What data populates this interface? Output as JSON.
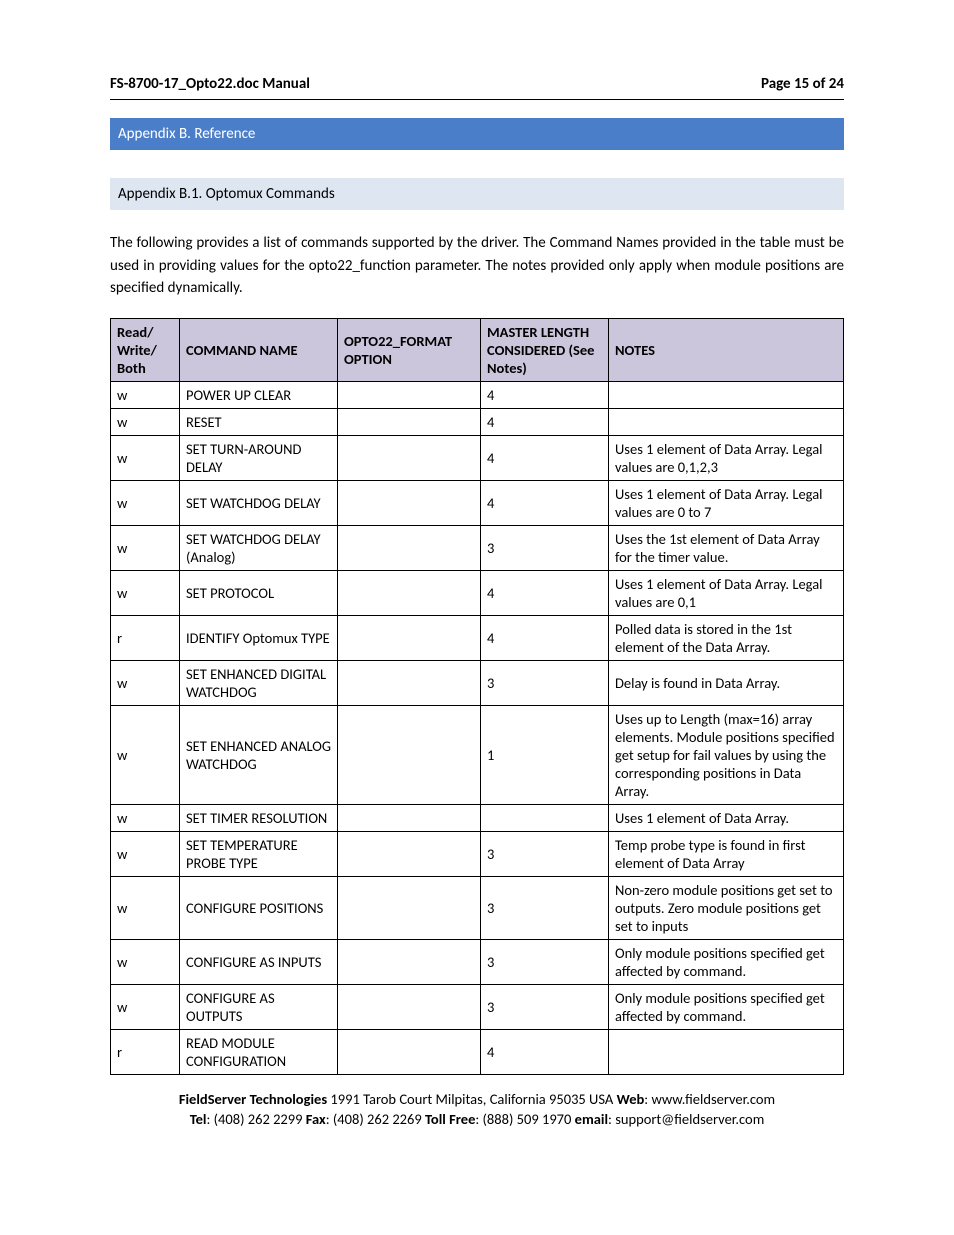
{
  "header": {
    "title": "FS-8700-17_Opto22.doc Manual",
    "page_label": "Page 15 of 24"
  },
  "section_main": "Appendix B.  Reference",
  "section_sub": "Appendix B.1.  Optomux Commands",
  "intro": "The following provides a list of commands supported by the driver.  The Command Names provided in the table must be used in providing values for the opto22_function parameter.  The notes provided only apply when module positions are specified dynamically.",
  "table": {
    "headers": {
      "rwb": "Read/ Write/ Both",
      "name": "COMMAND NAME",
      "fmt": "OPTO22_FORMAT OPTION",
      "len": "MASTER LENGTH CONSIDERED (See Notes)",
      "notes": "NOTES"
    },
    "rows": [
      {
        "rwb": "w",
        "name": "POWER UP CLEAR",
        "fmt": "",
        "len": "4",
        "notes": ""
      },
      {
        "rwb": "w",
        "name": "RESET",
        "fmt": "",
        "len": "4",
        "notes": ""
      },
      {
        "rwb": "w",
        "name": "SET TURN-AROUND DELAY",
        "fmt": "",
        "len": "4",
        "notes": "Uses 1 element of Data Array. Legal values are 0,1,2,3"
      },
      {
        "rwb": "w",
        "name": "SET WATCHDOG DELAY",
        "fmt": "",
        "len": "4",
        "notes": "Uses 1 element of Data Array. Legal values are 0 to 7"
      },
      {
        "rwb": "w",
        "name": "SET WATCHDOG DELAY (Analog)",
        "fmt": "",
        "len": "3",
        "notes": "Uses the 1st element of Data Array for the timer value."
      },
      {
        "rwb": "w",
        "name": "SET PROTOCOL",
        "fmt": "",
        "len": "4",
        "notes": "Uses 1 element of Data Array. Legal values are 0,1"
      },
      {
        "rwb": "r",
        "name": "IDENTIFY Optomux TYPE",
        "fmt": "",
        "len": "4",
        "notes": "Polled data is stored in the 1st element of the Data Array."
      },
      {
        "rwb": "w",
        "name": "SET ENHANCED DIGITAL WATCHDOG",
        "fmt": "",
        "len": "3",
        "notes": "Delay is found in Data Array."
      },
      {
        "rwb": "w",
        "name": "SET ENHANCED ANALOG WATCHDOG",
        "fmt": "",
        "len": "1",
        "notes": "Uses up to Length (max=16) array elements. Module positions specified get setup for fail values by using the corresponding positions in Data Array."
      },
      {
        "rwb": "w",
        "name": "SET TIMER RESOLUTION",
        "fmt": "",
        "len": "",
        "notes": "Uses 1 element of Data Array."
      },
      {
        "rwb": "w",
        "name": "SET TEMPERATURE PROBE TYPE",
        "fmt": "",
        "len": "3",
        "notes": "Temp probe type is found in first element of Data Array"
      },
      {
        "rwb": "w",
        "name": "CONFIGURE POSITIONS",
        "fmt": "",
        "len": "3",
        "notes": "Non-zero module positions get set to outputs. Zero module positions get set to inputs"
      },
      {
        "rwb": "w",
        "name": "CONFIGURE AS INPUTS",
        "fmt": "",
        "len": "3",
        "notes": "Only module positions specified get affected by command."
      },
      {
        "rwb": "w",
        "name": "CONFIGURE AS OUTPUTS",
        "fmt": "",
        "len": "3",
        "notes": "Only module positions specified get affected by command."
      },
      {
        "rwb": "r",
        "name": "READ MODULE CONFIGURATION",
        "fmt": "",
        "len": "4",
        "notes": ""
      }
    ]
  },
  "footer": {
    "company": "FieldServer Technologies",
    "address": " 1991 Tarob Court Milpitas, California 95035 USA   ",
    "web_label": "Web",
    "web": ": www.fieldserver.com",
    "tel_label": "Tel",
    "tel": ": (408) 262 2299   ",
    "fax_label": "Fax",
    "fax": ": (408) 262 2269   ",
    "tollfree_label": "Toll Free",
    "tollfree": ": (888) 509 1970   ",
    "email_label": "email",
    "email": ": support@fieldserver.com"
  }
}
